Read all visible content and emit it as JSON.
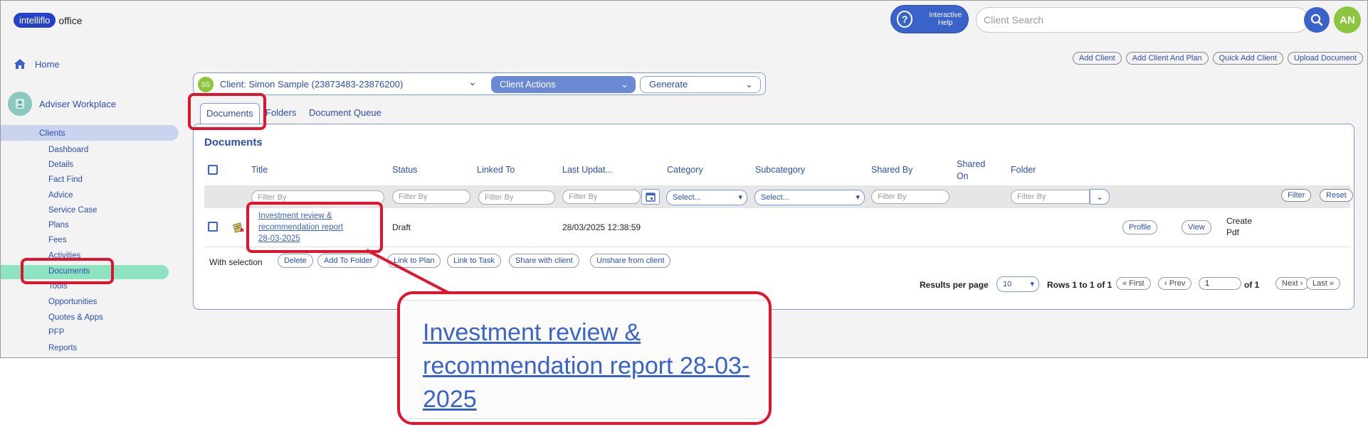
{
  "header": {
    "logo_pill": "intelliflo",
    "logo_text": "office",
    "help_label": "Interactive Help",
    "search_placeholder": "Client Search",
    "avatar": "AN"
  },
  "top_actions": [
    "Add Client",
    "Add Client And Plan",
    "Quick Add Client",
    "Upload Document"
  ],
  "sidebar": {
    "home": "Home",
    "adviser_workplace": "Adviser Workplace",
    "clients": "Clients",
    "items": [
      "Dashboard",
      "Details",
      "Fact Find",
      "Advice",
      "Service Case",
      "Plans",
      "Fees",
      "Activities",
      "Documents",
      "Tools",
      "Opportunities",
      "Quotes & Apps",
      "PFP",
      "Reports"
    ]
  },
  "client_bar": {
    "initials": "SS",
    "client_name": "Client: Simon Sample (23873483-23876200)",
    "actions": "Client Actions",
    "generate": "Generate"
  },
  "tabs": [
    "Documents",
    "Folders",
    "Document Queue"
  ],
  "documents": {
    "title": "Documents",
    "columns": [
      "Title",
      "Status",
      "Linked To",
      "Last Updat...",
      "Category",
      "Subcategory",
      "Shared By",
      "Shared On",
      "Folder"
    ],
    "filter_placeholder": "Filter By",
    "select_placeholder": "Select...",
    "filter_button": "Filter",
    "reset_button": "Reset",
    "row": {
      "title": "Investment review & recommendation report 28-03-2025",
      "status": "Draft",
      "last_updated": "28/03/2025 12:38:59",
      "profile": "Profile",
      "view": "View",
      "create_pdf": "Create Pdf"
    },
    "with_selection": "With selection",
    "selection_actions": [
      "Delete",
      "Add To Folder",
      "Link to Plan",
      "Link to Task",
      "Share with client",
      "Unshare from client"
    ],
    "pagination": {
      "results_per_page": "Results per page",
      "per_page_value": "10",
      "rows": "Rows 1 to 1 of 1",
      "first": "« First",
      "prev": "‹ Prev",
      "page": "1",
      "of": "of 1",
      "next": "Next ›",
      "last": "Last »"
    }
  },
  "zoom_callout": "Investment review & recommendation report 28-03-2025",
  "colors": {
    "accent": "#2b4fb0",
    "highlight": "#e0142d",
    "active_nav": "#8ee3c0"
  },
  "icons": [
    "home-icon",
    "user-icon",
    "question-icon",
    "search-icon",
    "document-icon",
    "calendar-icon",
    "chevron-down-icon"
  ]
}
